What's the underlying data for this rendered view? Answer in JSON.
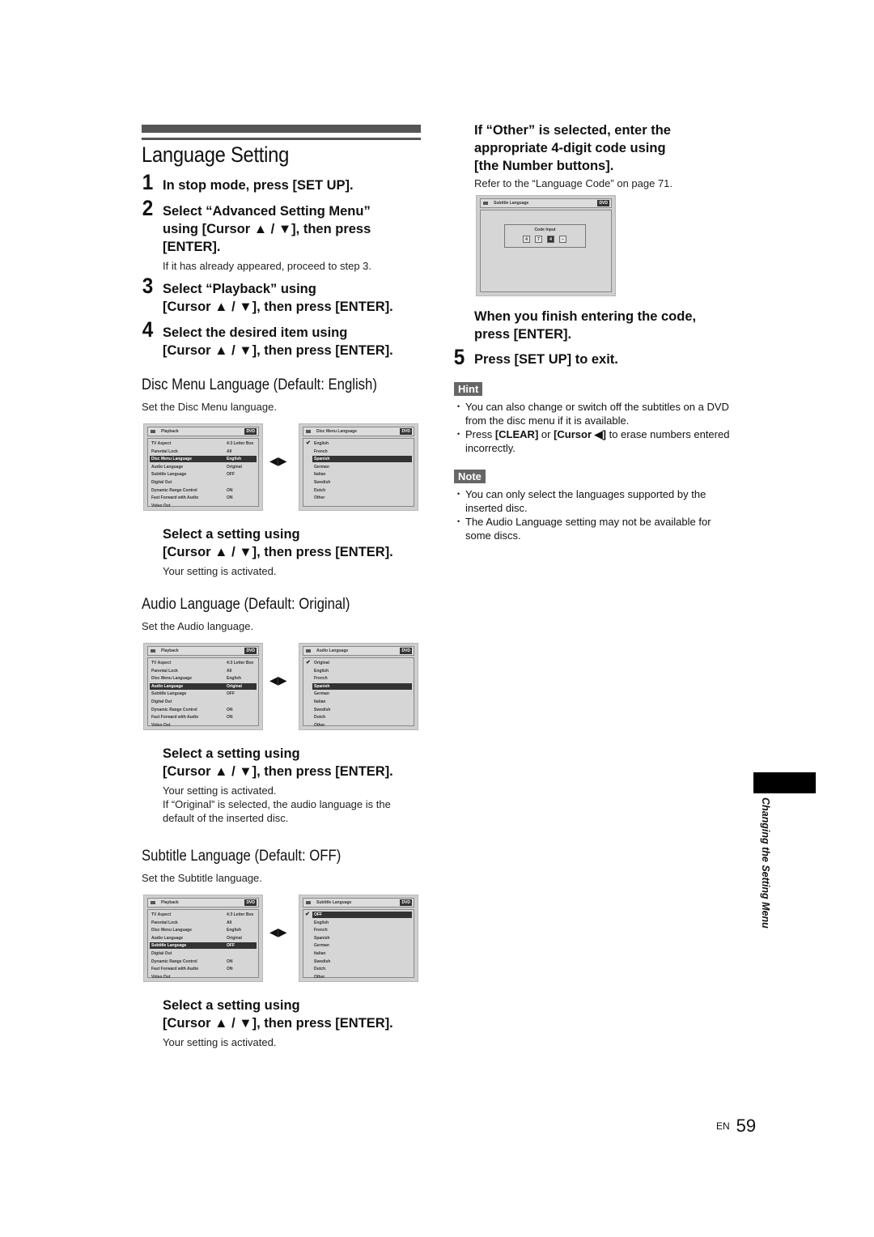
{
  "title": "Language Setting",
  "steps": [
    {
      "num": "1",
      "lines": [
        "In stop mode, press [SET UP]."
      ]
    },
    {
      "num": "2",
      "lines": [
        "Select “Advanced Setting Menu”",
        "using [Cursor ▲ / ▼], then press",
        "[ENTER]."
      ],
      "note": "If it has already appeared, proceed to step 3."
    },
    {
      "num": "3",
      "lines": [
        "Select “Playback” using",
        "[Cursor ▲ / ▼], then press [ENTER]."
      ]
    },
    {
      "num": "4",
      "lines": [
        "Select the desired item using",
        "[Cursor ▲ / ▼], then press [ENTER]."
      ]
    }
  ],
  "sections": [
    {
      "heading": "Disc Menu Language (Default: English)",
      "desc": "Set the Disc Menu language.",
      "left_screen": {
        "title": "Playback",
        "badge": "DVD",
        "rows": [
          {
            "label": "TV Aspect",
            "value": "4:3 Letter Box"
          },
          {
            "label": "Parental Lock",
            "value": "All"
          },
          {
            "label": "Disc Menu Language",
            "value": "English",
            "selected": true
          },
          {
            "label": "Audio Language",
            "value": "Original"
          },
          {
            "label": "Subtitle Language",
            "value": "OFF"
          },
          {
            "label": "Digital Out",
            "value": ""
          },
          {
            "label": "Dynamic Range Control",
            "value": "ON"
          },
          {
            "label": "Fast Forward with Audio",
            "value": "ON"
          },
          {
            "label": "Video Out",
            "value": ""
          }
        ]
      },
      "right_screen": {
        "title": "Disc Menu Language",
        "badge": "DVD",
        "options": [
          "English",
          "French",
          "Spanish",
          "German",
          "Italian",
          "Swedish",
          "Dutch",
          "Other"
        ],
        "checked": "English",
        "highlighted": "Spanish"
      },
      "instruction": [
        "Select a setting using",
        "[Cursor ▲ / ▼], then press [ENTER]."
      ],
      "result": [
        "Your setting is activated."
      ]
    },
    {
      "heading": "Audio Language (Default: Original)",
      "desc": "Set the Audio language.",
      "left_screen": {
        "title": "Playback",
        "badge": "DVD",
        "rows": [
          {
            "label": "TV Aspect",
            "value": "4:3 Letter Box"
          },
          {
            "label": "Parental Lock",
            "value": "All"
          },
          {
            "label": "Disc Menu Language",
            "value": "English"
          },
          {
            "label": "Audio Language",
            "value": "Original",
            "selected": true
          },
          {
            "label": "Subtitle Language",
            "value": "OFF"
          },
          {
            "label": "Digital Out",
            "value": ""
          },
          {
            "label": "Dynamic Range Control",
            "value": "ON"
          },
          {
            "label": "Fast Forward with Audio",
            "value": "ON"
          },
          {
            "label": "Video Out",
            "value": ""
          }
        ]
      },
      "right_screen": {
        "title": "Audio Language",
        "badge": "DVD",
        "options": [
          "Original",
          "English",
          "French",
          "Spanish",
          "German",
          "Italian",
          "Swedish",
          "Dutch",
          "Other"
        ],
        "checked": "Original",
        "highlighted": "Spanish"
      },
      "instruction": [
        "Select a setting using",
        "[Cursor ▲ / ▼], then press [ENTER]."
      ],
      "result": [
        "Your setting is activated.",
        "If “Original” is selected, the audio language is the",
        "default of the inserted disc."
      ]
    },
    {
      "heading": "Subtitle Language (Default: OFF)",
      "desc": "Set the Subtitle language.",
      "left_screen": {
        "title": "Playback",
        "badge": "DVD",
        "rows": [
          {
            "label": "TV Aspect",
            "value": "4:3 Letter Box"
          },
          {
            "label": "Parental Lock",
            "value": "All"
          },
          {
            "label": "Disc Menu Language",
            "value": "English"
          },
          {
            "label": "Audio Language",
            "value": "Original"
          },
          {
            "label": "Subtitle Language",
            "value": "OFF",
            "selected": true
          },
          {
            "label": "Digital Out",
            "value": ""
          },
          {
            "label": "Dynamic Range Control",
            "value": "ON"
          },
          {
            "label": "Fast Forward with Audio",
            "value": "ON"
          },
          {
            "label": "Video Out",
            "value": ""
          }
        ]
      },
      "right_screen": {
        "title": "Subtitle Language",
        "badge": "DVD",
        "options": [
          "OFF",
          "English",
          "French",
          "Spanish",
          "German",
          "Italian",
          "Swedish",
          "Dutch",
          "Other"
        ],
        "checked": "OFF",
        "highlighted": "OFF"
      },
      "instruction": [
        "Select a setting using",
        "[Cursor ▲ / ▼], then press [ENTER]."
      ],
      "result": [
        "Your setting is activated."
      ]
    }
  ],
  "right_column": {
    "other_heading": [
      "If “Other” is selected, enter the",
      "appropriate 4-digit code using",
      "[the Number buttons]."
    ],
    "other_note": "Refer to the “Language Code” on page 71.",
    "code_screen": {
      "title": "Subtitle Language",
      "badge": "DVD",
      "label": "Code Input",
      "digits": [
        "4",
        "7",
        "4",
        "–"
      ]
    },
    "finish": [
      "When you finish entering the code,",
      "press [ENTER]."
    ],
    "step5": {
      "num": "5",
      "text": "Press [SET UP] to exit."
    },
    "hint_label": "Hint",
    "hints": [
      {
        "parts": [
          {
            "t": "You can also change or switch off the subtitles on a DVD from the disc menu if it is available."
          }
        ]
      },
      {
        "parts": [
          {
            "t": "Press "
          },
          {
            "t": "[CLEAR]",
            "b": true
          },
          {
            "t": " or "
          },
          {
            "t": "[Cursor ◀]",
            "b": true
          },
          {
            "t": " to erase numbers entered incorrectly."
          }
        ]
      }
    ],
    "note_label": "Note",
    "notes": [
      "You can only select the languages supported by the inserted disc.",
      "The Audio Language setting may not be available for some discs."
    ]
  },
  "side_tab": "Changing the Setting Menu",
  "page": {
    "lang": "EN",
    "number": "59"
  }
}
